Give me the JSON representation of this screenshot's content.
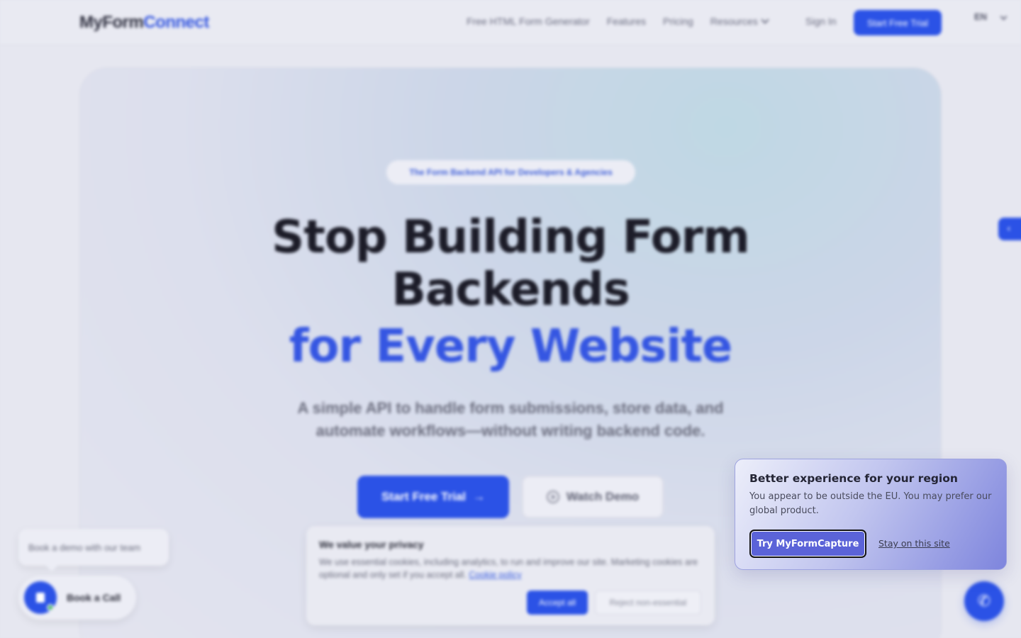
{
  "brand": {
    "name_part1": "MyForm",
    "name_part2": "Connect"
  },
  "nav": {
    "links": [
      "Free HTML Form Generator",
      "Features",
      "Pricing",
      "Resources"
    ],
    "signin": "Sign In",
    "cta": "Start Free Trial",
    "lang": "EN"
  },
  "hero": {
    "tagline": "The Form Backend API for Developers & Agencies",
    "title_line1": "Stop Building Form",
    "title_line2": "Backends",
    "title_line3": "for Every Website",
    "subtitle": "A simple API to handle form submissions, store data, and automate workflows—without writing backend code.",
    "primary_cta": "Start Free Trial",
    "secondary_cta": "Watch Demo"
  },
  "cookie": {
    "title": "We value your privacy",
    "text": "We use essential cookies, including analytics, to run and improve our site. Marketing cookies are optional and only set if you accept all.",
    "policy_link": "Cookie policy",
    "accept": "Accept all",
    "reject": "Reject non-essential"
  },
  "demo_widget": {
    "bubble": "Book a demo with our team",
    "button": "Book a Call"
  },
  "region_popup": {
    "title": "Better experience for your region",
    "text": "You appear to be outside the EU. You may prefer our global product.",
    "try_button": "Try MyFormCapture",
    "stay_link": "Stay on this site"
  },
  "colors": {
    "accent": "#2b52e6",
    "popup_button": "#5b63d8"
  },
  "icons": {
    "side_tab": "chevron-left-icon",
    "phone": "phone-icon",
    "play": "play-circle-icon",
    "arrow": "arrow-right-icon"
  }
}
